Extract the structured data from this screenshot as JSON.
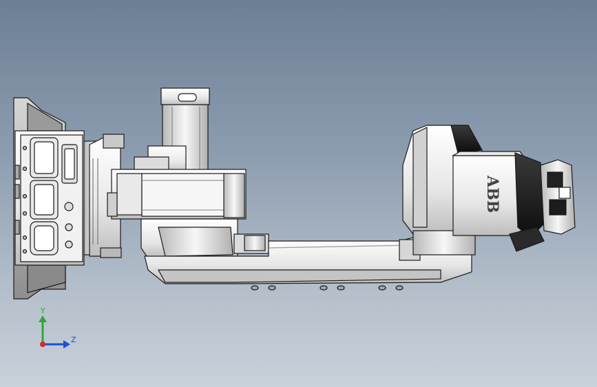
{
  "model": {
    "brand_text": "ABB"
  },
  "triad": {
    "y_label": "Y",
    "z_label": "Z",
    "colors": {
      "y_axis": "#2ea836",
      "z_axis": "#1f4fd1",
      "origin": "#d9262d"
    }
  },
  "viewport": {
    "background_top": "#6d7f95",
    "background_bottom": "#c9d1da"
  }
}
